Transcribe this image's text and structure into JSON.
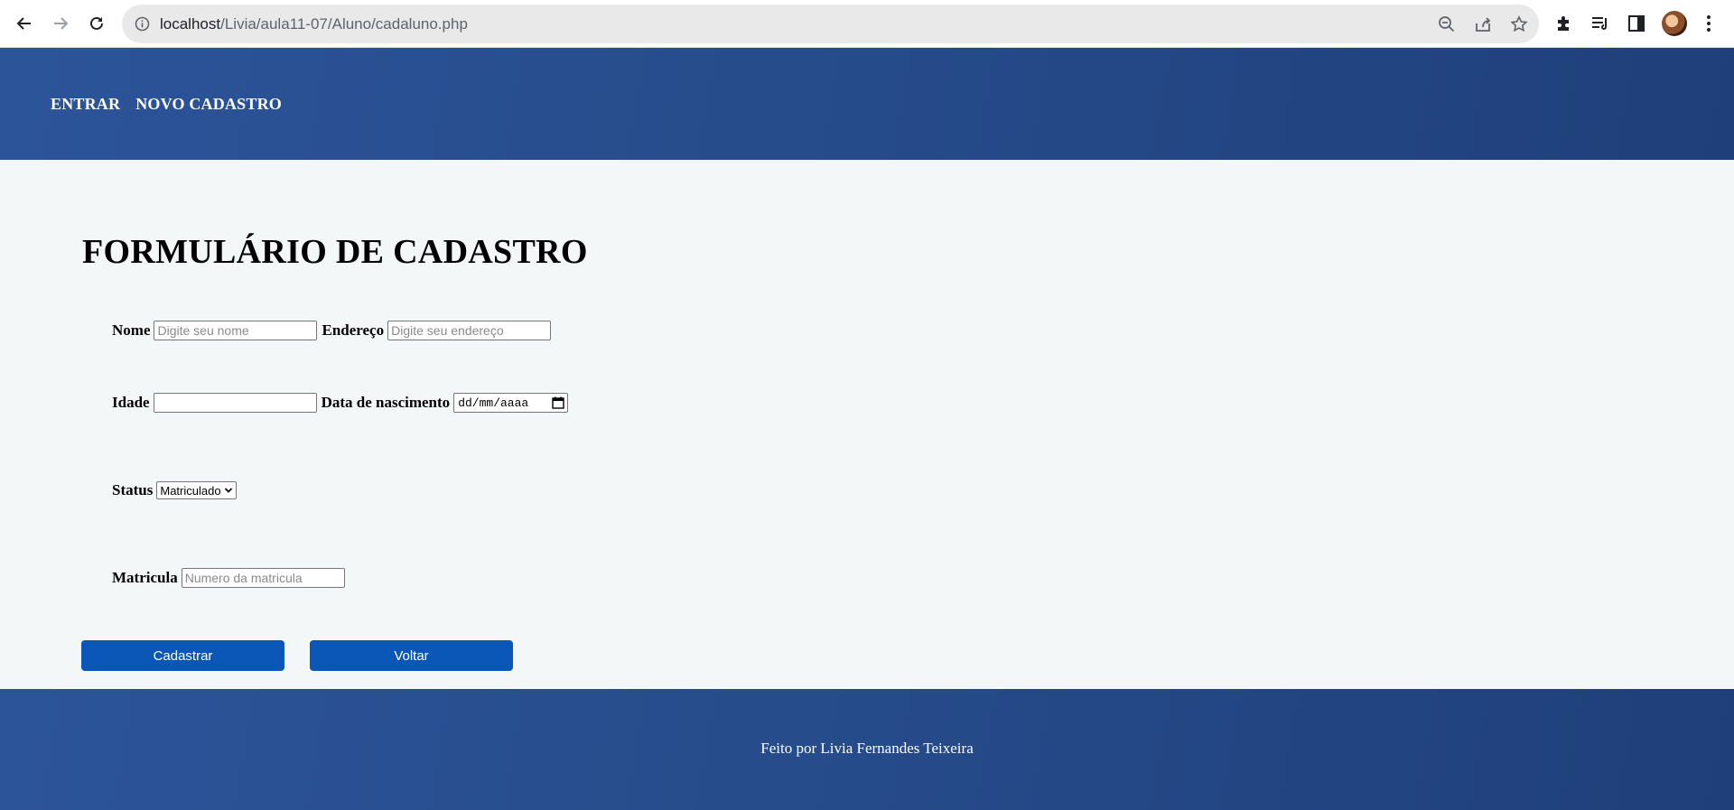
{
  "browser": {
    "url_host": "localhost",
    "url_path": "/Livia/aula11-07/Aluno/cadaluno.php"
  },
  "nav": {
    "items": [
      {
        "label": "ENTRAR"
      },
      {
        "label": "NOVO CADASTRO"
      }
    ]
  },
  "form": {
    "title": "FORMULÁRIO DE CADASTRO",
    "nome": {
      "label": "Nome",
      "placeholder": "Digite seu nome",
      "value": ""
    },
    "endereco": {
      "label": "Endereço",
      "placeholder": "Digite seu endereço",
      "value": ""
    },
    "idade": {
      "label": "Idade",
      "value": ""
    },
    "nascimento": {
      "label": "Data de nascimento",
      "value": "dd/mm/aaaa"
    },
    "status": {
      "label": "Status",
      "selected": "Matriculado"
    },
    "matricula": {
      "label": "Matricula",
      "placeholder": "Numero da matricula",
      "value": ""
    },
    "submit_label": "Cadastrar",
    "back_label": "Voltar"
  },
  "footer": {
    "text": "Feito por Livia Fernandes Teixeira"
  },
  "colors": {
    "header_bg": "#2c5499",
    "button_bg": "#0a57b8",
    "page_bg": "#f3f7f8"
  }
}
